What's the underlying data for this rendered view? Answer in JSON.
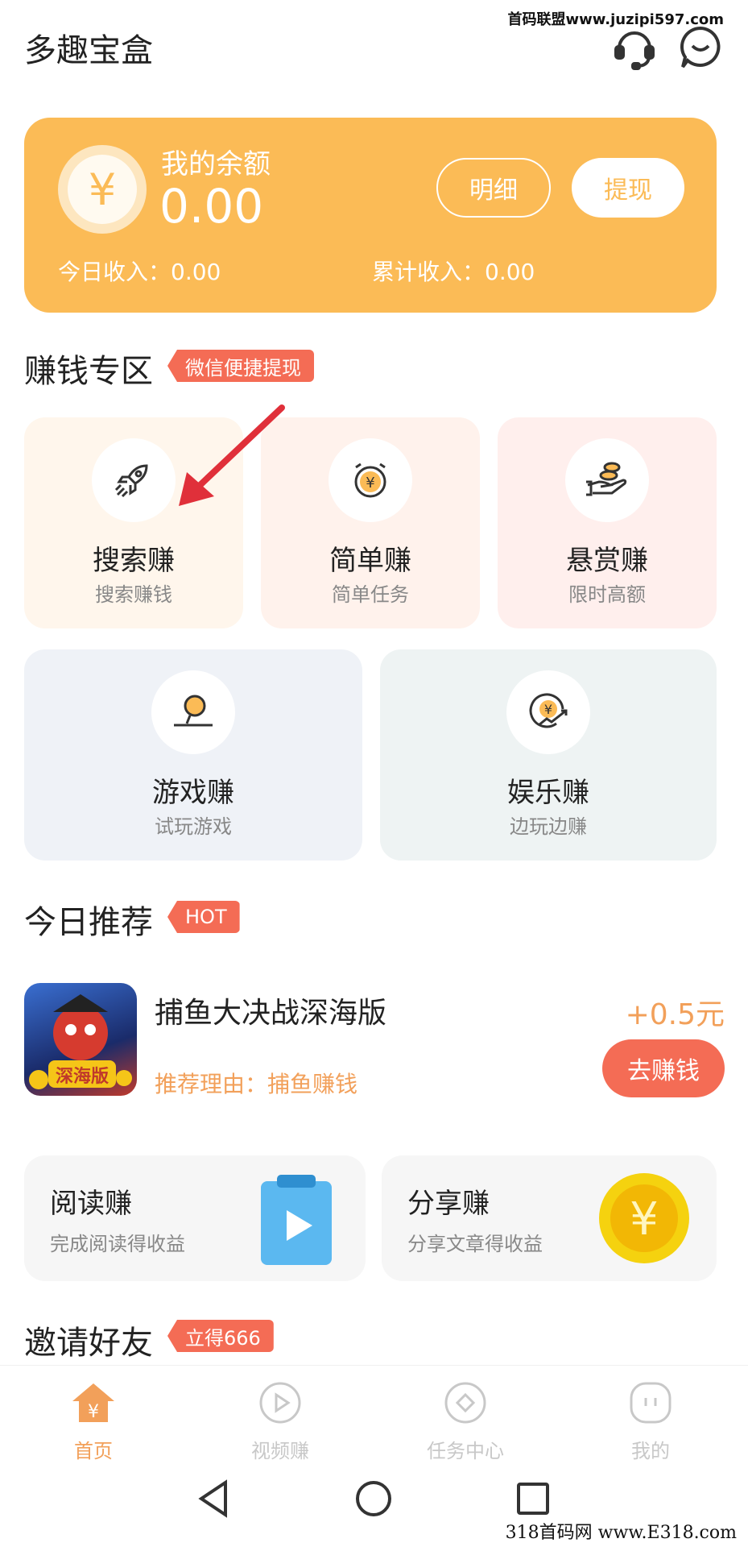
{
  "watermark": {
    "top": "首码联盟www.juzipi597.com",
    "bottom": "318首码网 www.E318.com"
  },
  "header": {
    "title": "多趣宝盒",
    "support_icon": "headset-icon",
    "message_icon": "smile-chat-icon"
  },
  "balance": {
    "label": "我的余额",
    "value": "0.00",
    "currency_symbol": "¥",
    "detail_button": "明细",
    "withdraw_button": "提现",
    "today_income": "今日收入：0.00",
    "total_income": "累计收入：0.00"
  },
  "earn_section": {
    "title": "赚钱专区",
    "tag": "微信便捷提现",
    "tiles": [
      {
        "title": "搜索赚",
        "subtitle": "搜索赚钱",
        "icon": "rocket-icon"
      },
      {
        "title": "简单赚",
        "subtitle": "简单任务",
        "icon": "alarm-coin-icon"
      },
      {
        "title": "悬赏赚",
        "subtitle": "限时高额",
        "icon": "hand-coins-icon"
      },
      {
        "title": "游戏赚",
        "subtitle": "试玩游戏",
        "icon": "game-ball-icon"
      },
      {
        "title": "娱乐赚",
        "subtitle": "边玩边赚",
        "icon": "coin-trend-icon"
      }
    ]
  },
  "recommend": {
    "title": "今日推荐",
    "tag": "HOT",
    "item": {
      "name": "捕鱼大决战深海版",
      "reason": "推荐理由：捕鱼赚钱",
      "reward": "+0.5元",
      "button": "去赚钱",
      "icon_text": "深海版"
    }
  },
  "cards": [
    {
      "title": "阅读赚",
      "subtitle": "完成阅读得收益",
      "icon": "clipboard-play-icon"
    },
    {
      "title": "分享赚",
      "subtitle": "分享文章得收益",
      "icon": "gold-coin-icon"
    }
  ],
  "invite": {
    "title": "邀请好友",
    "tag": "立得666"
  },
  "bottom_nav": [
    {
      "label": "首页",
      "icon": "home-icon",
      "active": true
    },
    {
      "label": "视频赚",
      "icon": "video-icon",
      "active": false
    },
    {
      "label": "任务中心",
      "icon": "task-icon",
      "active": false
    },
    {
      "label": "我的",
      "icon": "profile-icon",
      "active": false
    }
  ],
  "colors": {
    "accent": "#fbbb56",
    "tag_red": "#f46c55",
    "reward_orange": "#f2a05a"
  }
}
